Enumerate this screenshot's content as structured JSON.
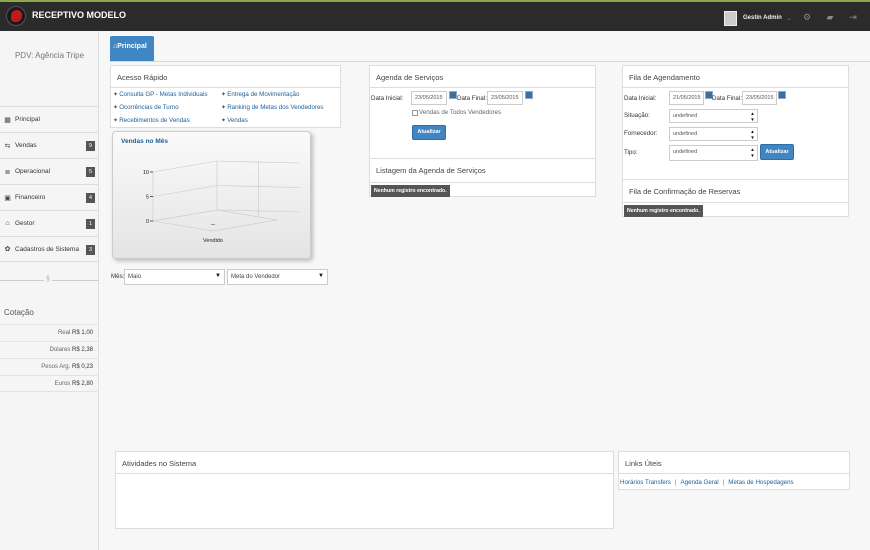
{
  "app": {
    "title": "RECEPTIVO MODELO",
    "user_name": "Gestin Admin",
    "caret": "⌄"
  },
  "sidebar": {
    "pdv": "PDV: Agência Tripe",
    "items": [
      {
        "label": "Principal",
        "icon": "grid-icon",
        "glyph": "▦",
        "badge": ""
      },
      {
        "label": "Vendas",
        "icon": "transfer-icon",
        "glyph": "⇆",
        "badge": "9"
      },
      {
        "label": "Operacional",
        "icon": "list-icon",
        "glyph": "≣",
        "badge": "5"
      },
      {
        "label": "Financeiro",
        "icon": "money-icon",
        "glyph": "▣",
        "badge": "4"
      },
      {
        "label": "Gestor",
        "icon": "bank-icon",
        "glyph": "⌂",
        "badge": "1"
      },
      {
        "label": "Cadastros de Sistema",
        "icon": "gear-icon",
        "glyph": "✿",
        "badge": "3"
      }
    ],
    "divider_symbol": "§",
    "cotacao": {
      "title": "Cotação",
      "rows": [
        {
          "label": "Real",
          "value": "R$ 1,00"
        },
        {
          "label": "Dolares",
          "value": "R$ 2,38"
        },
        {
          "label": "Pesos Arg.",
          "value": "R$ 0,23"
        },
        {
          "label": "Euros",
          "value": "R$ 2,80"
        }
      ]
    }
  },
  "main": {
    "tab_label": "Principal"
  },
  "acesso_rapido": {
    "title": "Acesso Rápido",
    "links": [
      "Consulta GP - Metas Individuais",
      "Ocorrências de Turno",
      "Recebimentos de Vendas",
      "Entrega de Movimentação",
      "Ranking de Metas dos Vendedores",
      "Vendas"
    ]
  },
  "vendas_chart": {
    "title": "Vendas no Mês",
    "mes_label": "Mês:",
    "mes_value": "Maio",
    "meta_value": "Meta do Vendedor",
    "dropdown_arrow": "▼"
  },
  "chart_data": {
    "type": "bar",
    "title": "Vendas no Mês",
    "categories": [
      "Vendido"
    ],
    "values": [
      0
    ],
    "ylim": [
      0,
      10
    ],
    "yticks": [
      "0",
      "5",
      "10"
    ],
    "xlabel": "Vendido",
    "ylabel": "",
    "grid": true,
    "style": "3d"
  },
  "agenda_servicos": {
    "title": "Agenda de Serviços",
    "data_inicial_label": "Data Inicial:",
    "data_inicial": "23/05/2015",
    "data_final_label": "Data Final:",
    "data_final": "23/05/2015",
    "checkbox_label": "Vendas de Todos Vendedores",
    "button": "Atualizar",
    "listagem_title": "Listagem da Agenda de Serviços",
    "empty_msg": "Nenhum registro encontrado."
  },
  "fila_agendamento": {
    "title": "Fila de Agendamento",
    "data_inicial_label": "Data Inicial:",
    "data_inicial": "21/05/2015",
    "data_final_label": "Data Final:",
    "data_final": "23/05/2015",
    "situacao_label": "Situação:",
    "situacao": "undefined",
    "fornecedor_label": "Fornecedor:",
    "fornecedor": "undefined",
    "tipo_label": "Tipo:",
    "tipo": "undefined",
    "button": "Atualizar",
    "spin_up": "▲",
    "spin_down": "▼",
    "confirmacao_title": "Fila de Confirmação de Reservas",
    "empty_msg": "Nenhum registro encontrado."
  },
  "atividades": {
    "title": "Atividades no Sistema"
  },
  "links_uteis": {
    "title": "Links Úteis",
    "links": [
      "Horários Transfers",
      "Agenda Geral",
      "Metas de Hospedagens"
    ],
    "separator": "|"
  }
}
